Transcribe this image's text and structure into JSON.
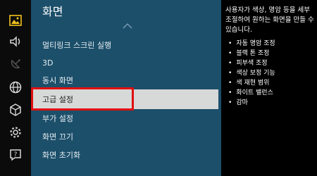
{
  "sidebar": {
    "icons": [
      {
        "name": "picture-icon",
        "active": true
      },
      {
        "name": "sound-icon",
        "active": false
      },
      {
        "name": "broadcast-icon",
        "active": false
      },
      {
        "name": "network-icon",
        "active": false
      },
      {
        "name": "smart-features-icon",
        "active": false
      },
      {
        "name": "system-icon",
        "active": false
      },
      {
        "name": "support-icon",
        "active": false
      }
    ],
    "active_color": "#f2c21b"
  },
  "menu": {
    "title": "화면",
    "items": [
      {
        "label": "멀티링크 스크린 실행"
      },
      {
        "label": "3D"
      },
      {
        "label": "동시 화면"
      },
      {
        "label": "고급 설정",
        "selected": true
      },
      {
        "label": "부가 설정"
      },
      {
        "label": "화면 끄기"
      },
      {
        "label": "화면 초기화"
      }
    ]
  },
  "help": {
    "description": "사용자가 색상, 명암 등을 세부 조절하여 원하는 화면을 만들 수 있습니다.",
    "bullets": [
      "자동 명암 조정",
      "블랙 톤 조정",
      "피부색 조정",
      "색상 보정 기능",
      "색 재현 범위",
      "화이트 밸런스",
      "감마"
    ]
  },
  "colors": {
    "menu_bg": "#1c4f6a",
    "selected_bg": "#d7d8d8",
    "highlight": "#e01010"
  }
}
